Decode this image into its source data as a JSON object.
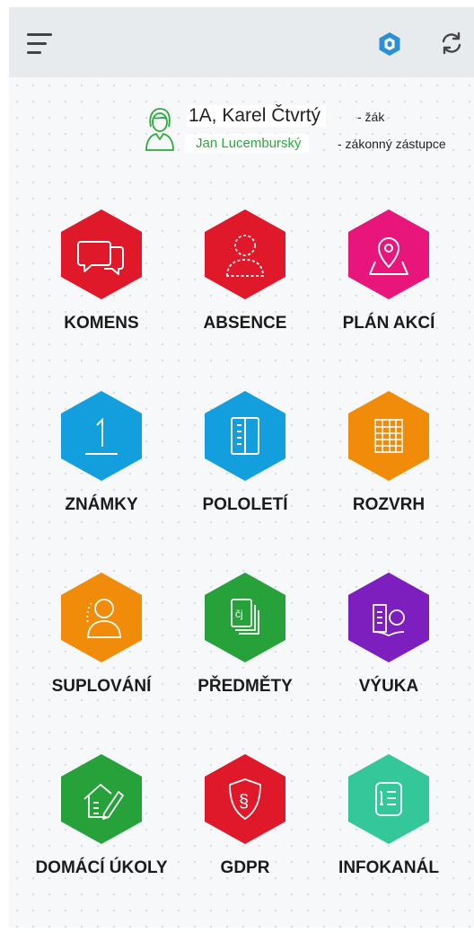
{
  "header": {
    "menu_icon": "hamburger-icon",
    "logo_icon": "bakalari-logo-icon",
    "refresh_icon": "refresh-icon"
  },
  "user": {
    "student": "1A, Karel Čtvrtý",
    "student_role": "- žák",
    "guardian": "Jan Lucemburský",
    "guardian_role": "- zákonný zástupce",
    "guardian_color": "#2aaa3a"
  },
  "tiles": [
    {
      "label": "KOMENS",
      "icon": "chat-bubbles-icon",
      "color": "#e0192a"
    },
    {
      "label": "ABSENCE",
      "icon": "person-outline-icon",
      "color": "#e0192a"
    },
    {
      "label": "PLÁN AKCÍ",
      "icon": "map-pin-icon",
      "color": "#e8157a"
    },
    {
      "label": "ZNÁMKY",
      "icon": "grade-one-icon",
      "color": "#139fde"
    },
    {
      "label": "POLOLETÍ",
      "icon": "report-book-icon",
      "color": "#139fde"
    },
    {
      "label": "ROZVRH",
      "icon": "timetable-grid-icon",
      "color": "#f08c0a"
    },
    {
      "label": "SUPLOVÁNÍ",
      "icon": "substitute-person-icon",
      "color": "#f08c0a"
    },
    {
      "label": "PŘEDMĚTY",
      "icon": "subject-docs-icon",
      "color": "#27a23a"
    },
    {
      "label": "VÝUKA",
      "icon": "open-book-icon",
      "color": "#7d1fbf"
    },
    {
      "label": "DOMÁCÍ ÚKOLY",
      "icon": "house-pencil-icon",
      "color": "#27a23a"
    },
    {
      "label": "GDPR",
      "icon": "shield-paragraph-icon",
      "color": "#e0192a"
    },
    {
      "label": "INFOKANÁL",
      "icon": "info-list-icon",
      "color": "#33c79a"
    }
  ]
}
